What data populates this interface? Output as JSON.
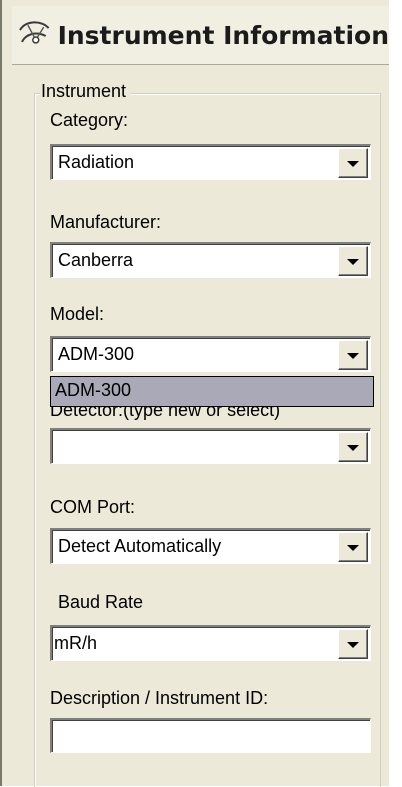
{
  "window": {
    "title": "Instrument Information",
    "icon": "instrument-icon"
  },
  "group": {
    "legend": "Instrument"
  },
  "fields": {
    "category": {
      "label": "Category:",
      "value": "Radiation"
    },
    "manufacturer": {
      "label": "Manufacturer:",
      "value": "Canberra"
    },
    "model": {
      "label": "Model:",
      "value": "ADM-300"
    },
    "detector": {
      "label": "Detector:(type new or select)",
      "value": ""
    },
    "com_port": {
      "label": "COM Port:",
      "value": "Detect Automatically"
    },
    "baud_rate": {
      "label": "Baud Rate",
      "value": "mR/h"
    },
    "description": {
      "label": "Description / Instrument ID:",
      "value": ""
    }
  },
  "model_dropdown": {
    "options": [
      "ADM-300"
    ]
  }
}
